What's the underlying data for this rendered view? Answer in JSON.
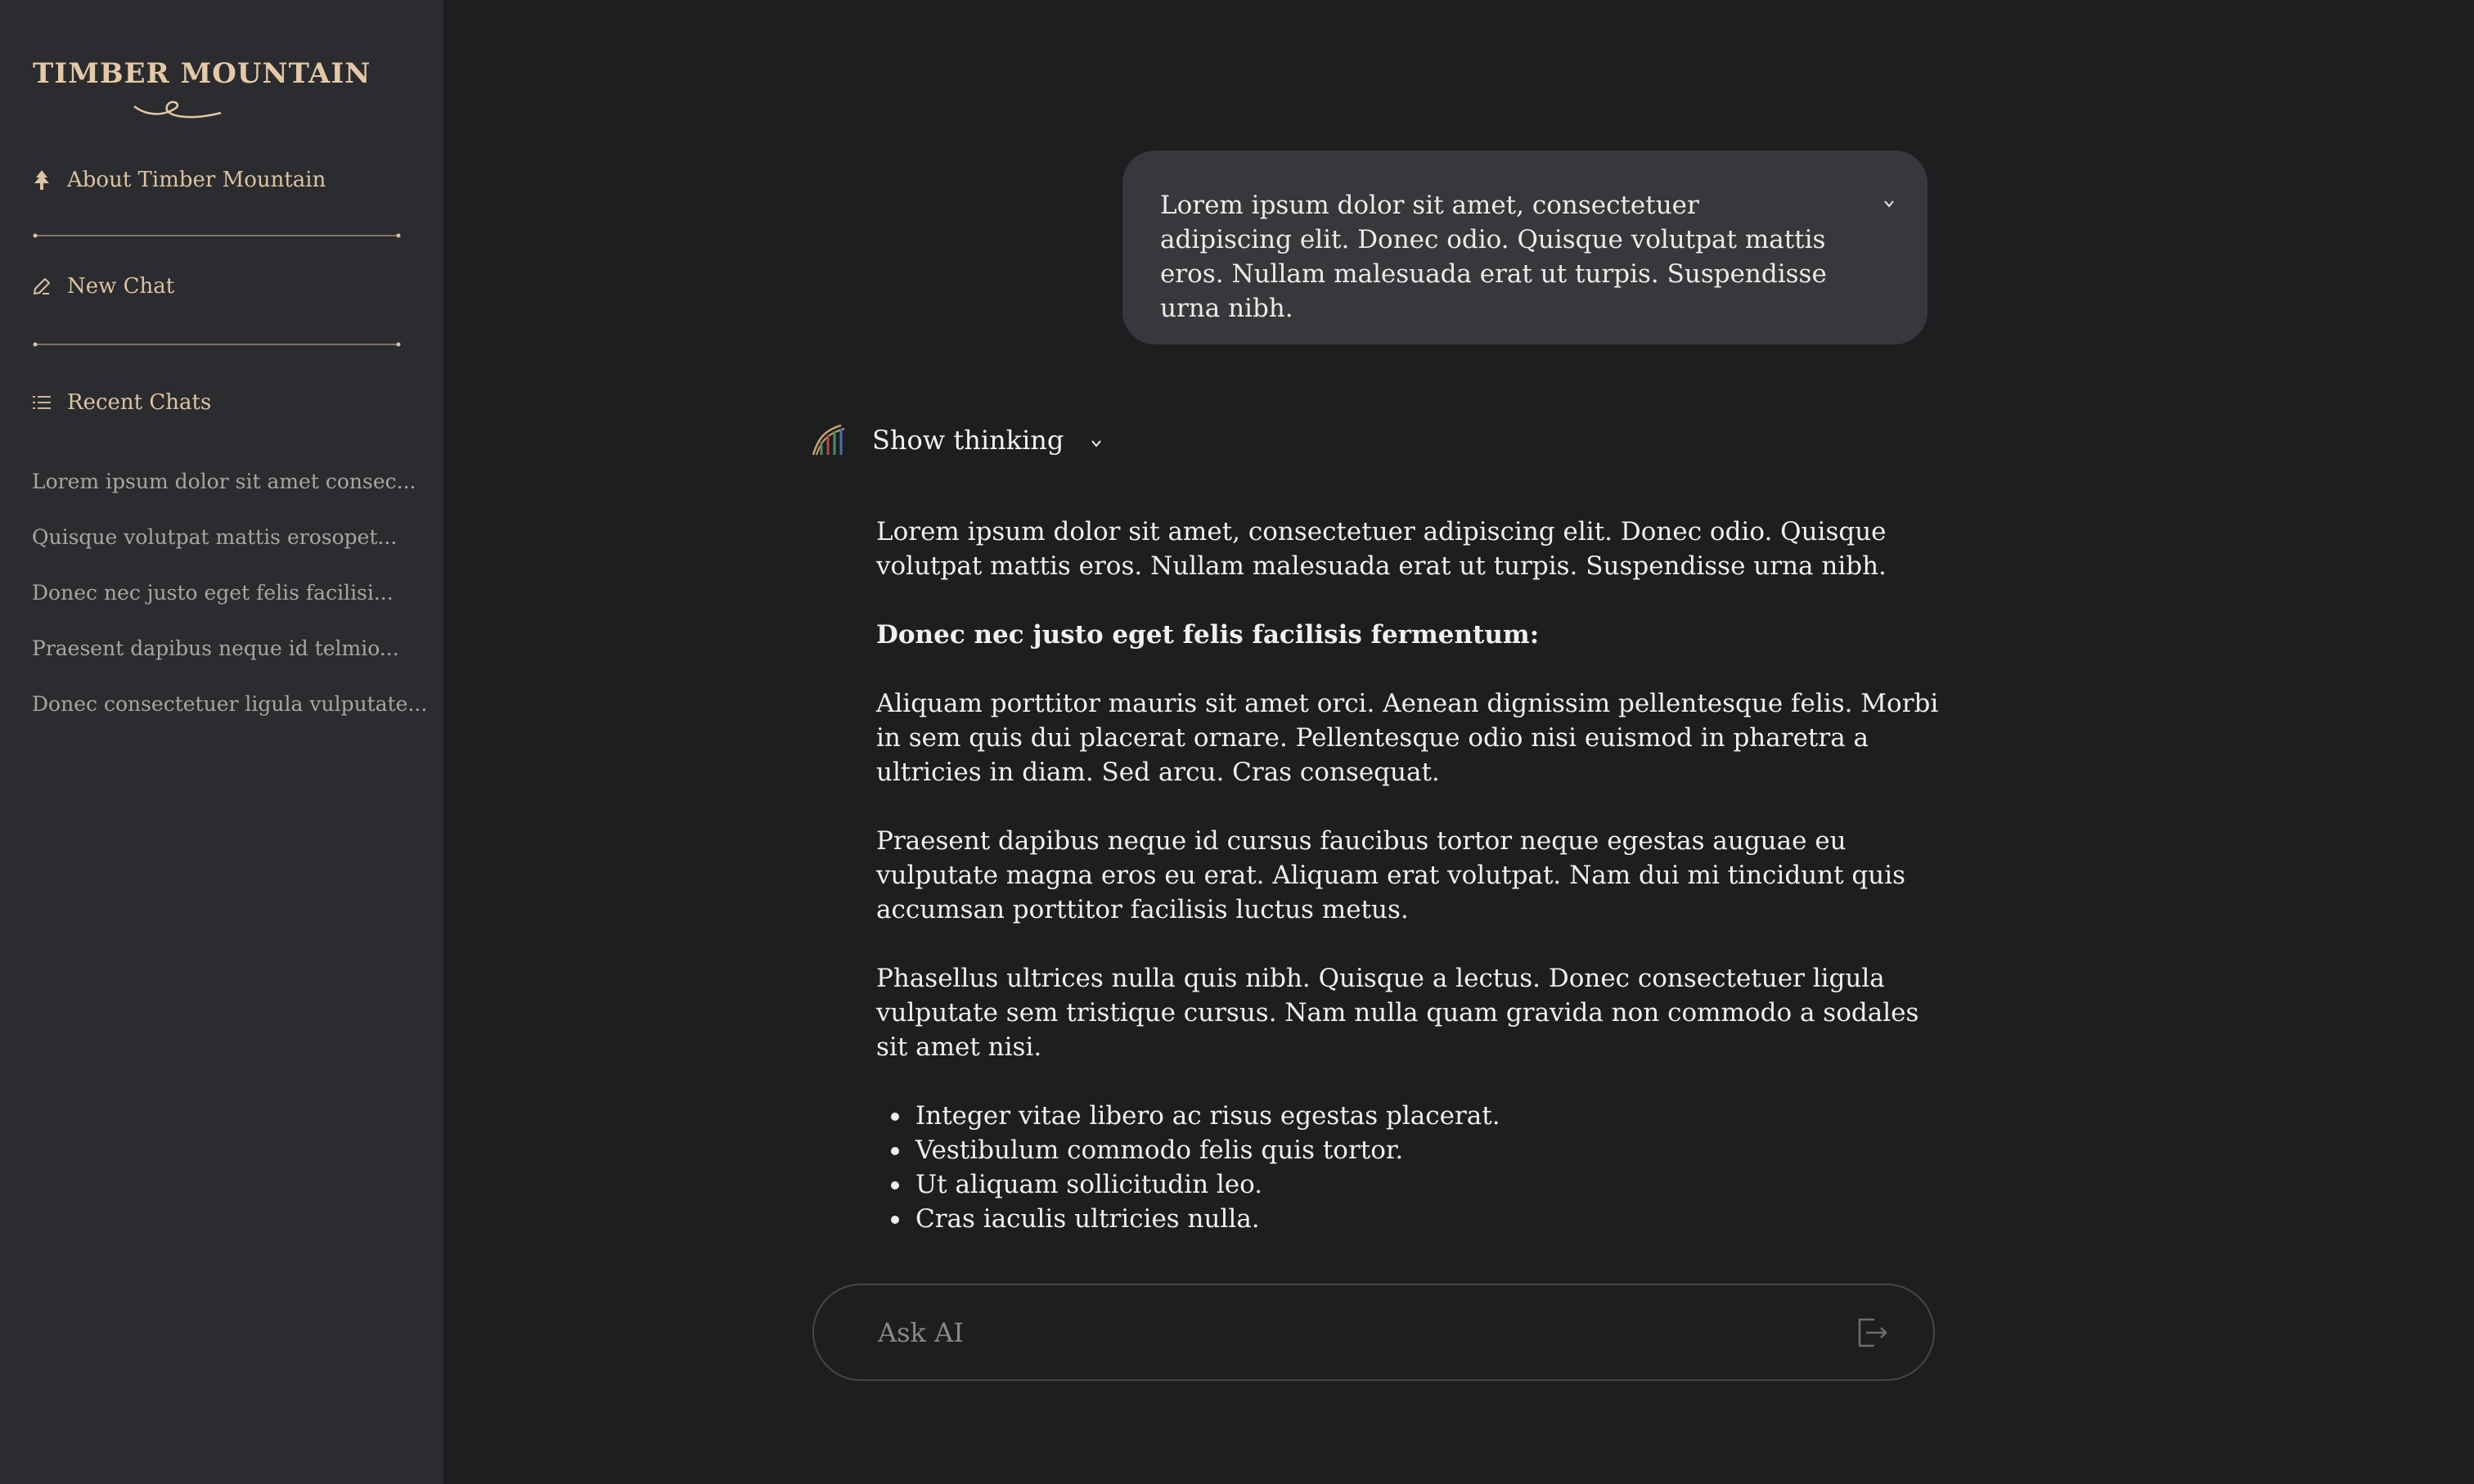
{
  "sidebar": {
    "logo_text": "TIMBER MOUNTAIN",
    "about_label": "About Timber Mountain",
    "new_chat_label": "New Chat",
    "recent_label": "Recent Chats",
    "recent_chats": [
      "Lorem ipsum dolor sit amet consec...",
      "Quisque volutpat mattis erosopet...",
      "Donec nec justo eget felis facilisi...",
      "Praesent dapibus neque id telmio...",
      "Donec consectetuer ligula vulputate..."
    ]
  },
  "conversation": {
    "user_message": "Lorem ipsum dolor sit amet, consectetuer adipiscing elit. Donec odio. Quisque volutpat mattis eros. Nullam malesuada erat ut turpis. Suspendisse urna nibh.",
    "thinking_label": "Show thinking",
    "answer": {
      "intro": "Lorem ipsum dolor sit amet, consectetuer adipiscing elit. Donec odio. Quisque volutpat mattis eros. Nullam malesuada erat ut turpis. Suspendisse urna nibh.",
      "heading": "Donec nec justo eget felis facilisis fermentum:",
      "para1": "Aliquam porttitor mauris sit amet orci. Aenean dignissim pellentesque felis. Morbi in sem quis dui placerat ornare. Pellentesque odio nisi euismod in pharetra a ultricies in diam. Sed arcu. Cras consequat.",
      "para2": "Praesent dapibus neque id cursus faucibus tortor neque egestas auguae eu vulputate magna eros eu erat. Aliquam erat volutpat. Nam dui mi tincidunt quis accumsan porttitor facilisis luctus metus.",
      "para3": "Phasellus ultrices nulla quis nibh. Quisque a lectus. Donec consectetuer ligula vulputate sem tristique cursus. Nam nulla quam gravida non commodo a sodales sit amet nisi.",
      "bullets": [
        "Integer vitae libero ac risus egestas placerat.",
        "Vestibulum commodo felis quis tortor.",
        "Ut aliquam sollicitudin leo.",
        "Cras iaculis ultricies nulla."
      ]
    }
  },
  "composer": {
    "placeholder": "Ask AI"
  },
  "icons": {
    "about": "tree-icon",
    "new_chat": "pencil-icon",
    "recent": "list-icon",
    "avatar": "rollercoaster-icon",
    "send": "send-icon",
    "chevron": "chevron-down-icon"
  },
  "colors": {
    "background": "#1d1e20",
    "sidebar": "#2b2c2f",
    "accent": "#dcc3a1",
    "bubble": "#37383b"
  }
}
